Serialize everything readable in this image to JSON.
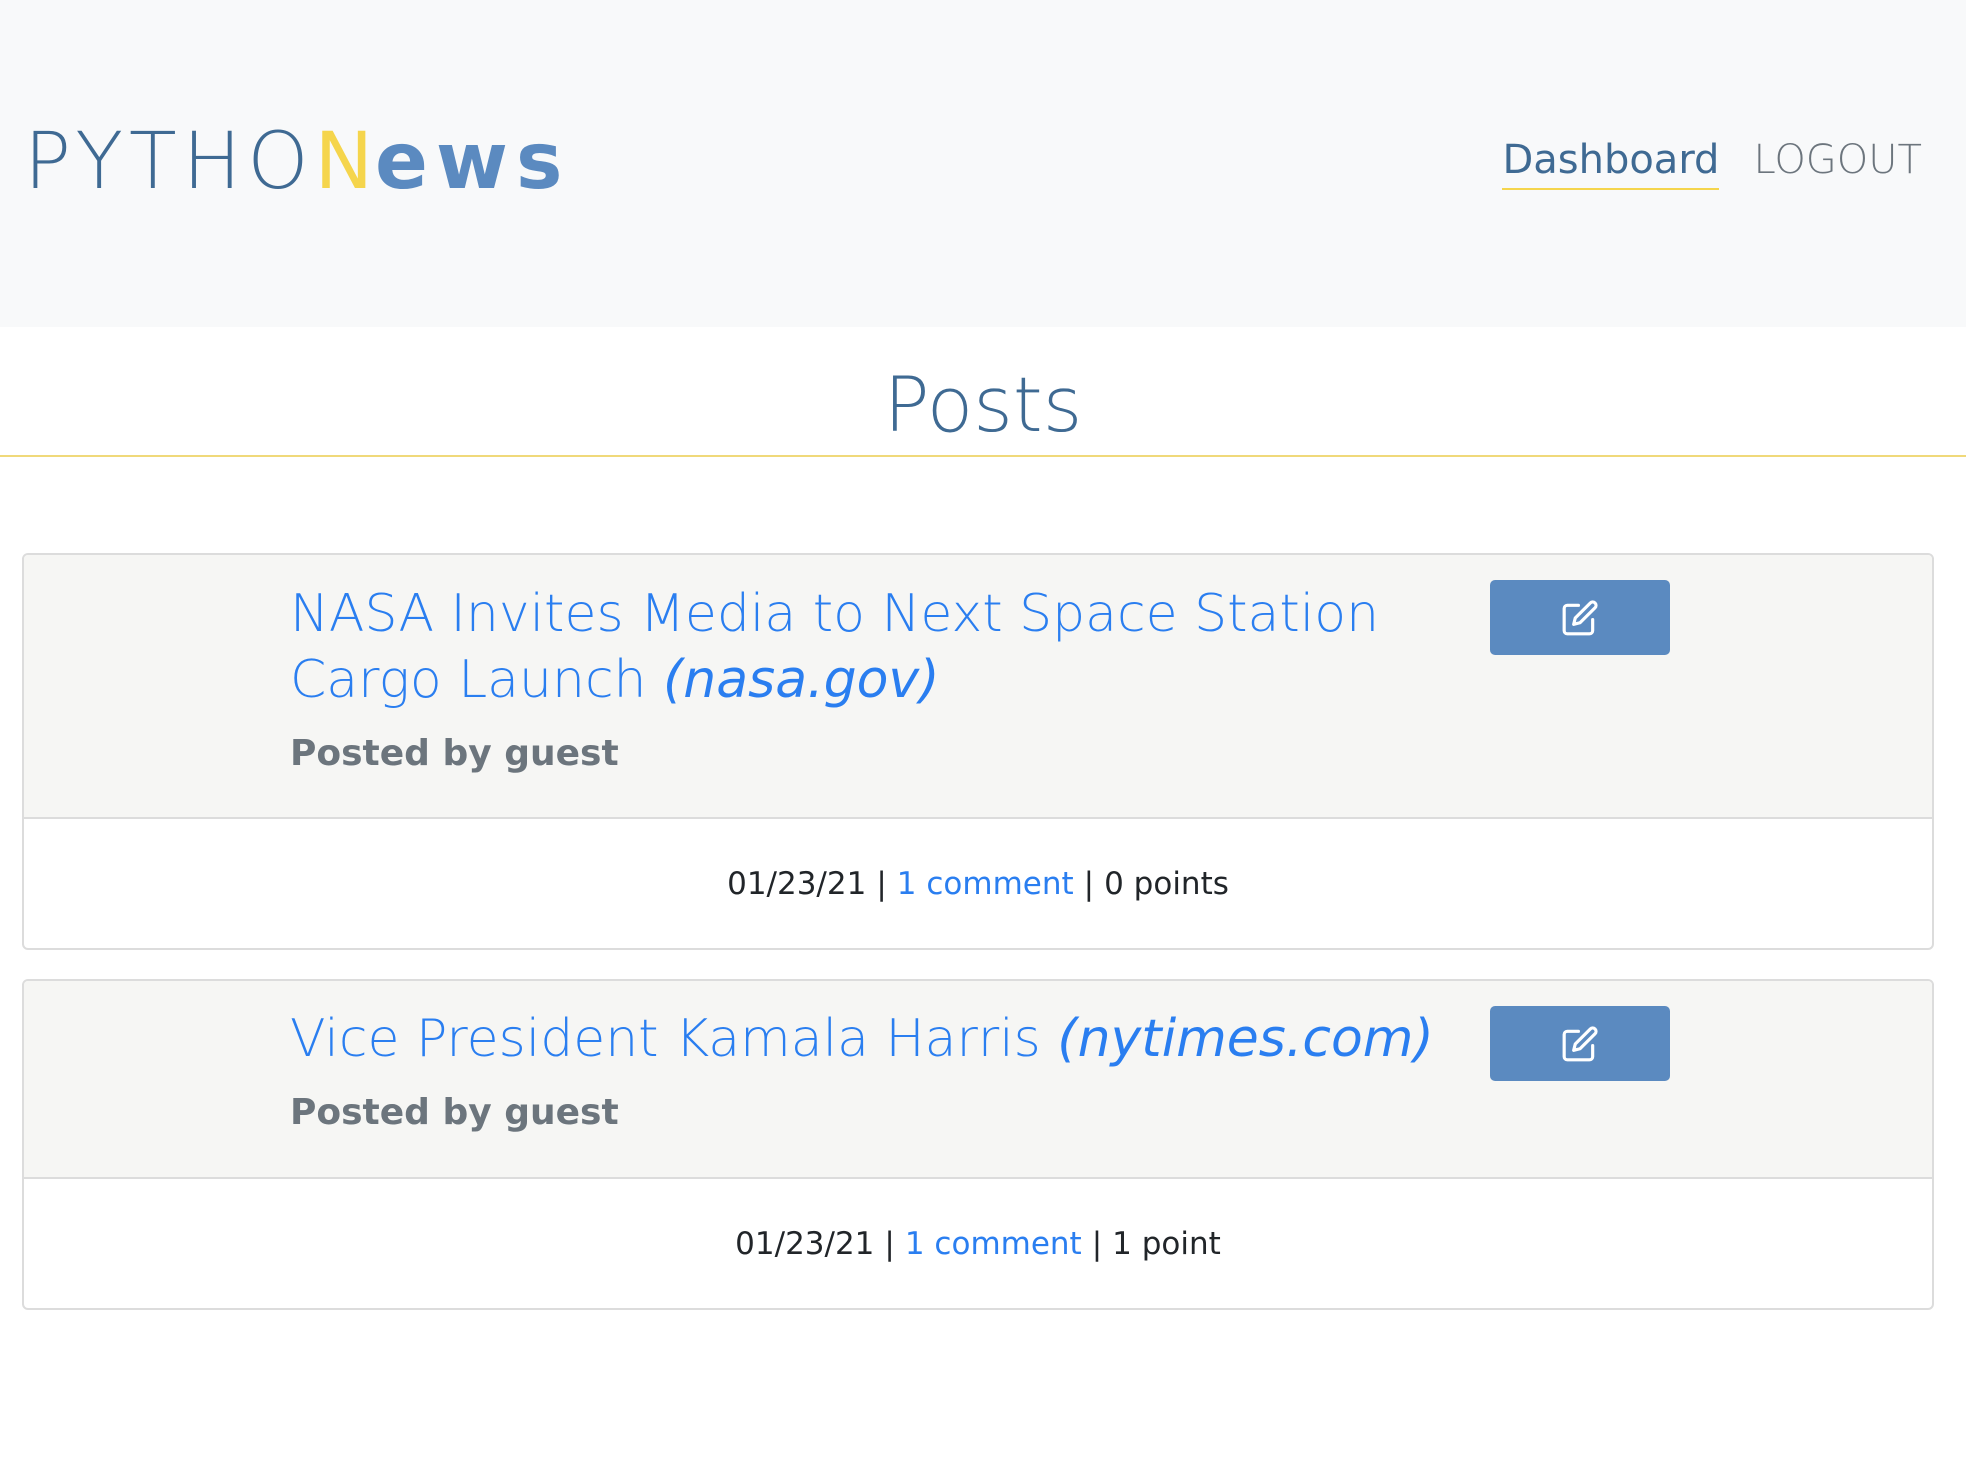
{
  "brand": {
    "part1": "PYTHO",
    "part2": "N",
    "part3": "ews"
  },
  "nav": {
    "dashboard": "Dashboard",
    "logout": "LOGOUT"
  },
  "page": {
    "title": "Posts"
  },
  "posts": [
    {
      "title": "NASA Invites Media to Next Space Station Cargo Launch",
      "domain": "(nasa.gov)",
      "posted_by": "Posted by guest",
      "date": "01/23/21",
      "comments": "1 comment",
      "points": "0 points"
    },
    {
      "title": "Vice President Kamala Harris",
      "domain": "(nytimes.com)",
      "posted_by": "Posted by guest",
      "date": "01/23/21",
      "comments": "1 comment",
      "points": "1 point"
    }
  ],
  "colors": {
    "navbar_bg": "#f8f9fa",
    "brand_dark": "#3f6a93",
    "brand_yellow": "#f5d54c",
    "brand_light": "#5b8ac0",
    "link_blue": "#2a7ef0",
    "edit_button": "#5b8ac0"
  },
  "icons": {
    "edit": "edit-icon"
  }
}
